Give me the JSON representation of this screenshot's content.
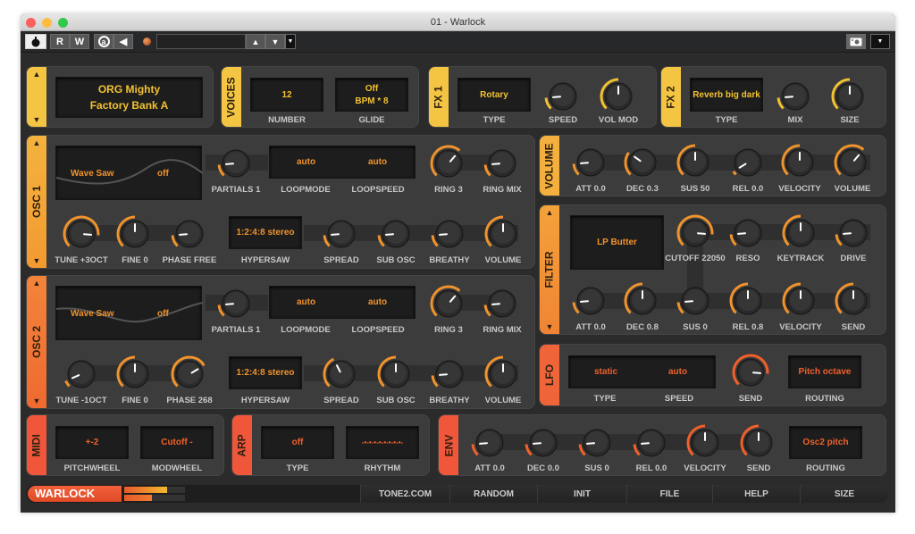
{
  "window": {
    "title": "01 - Warlock"
  },
  "host": {
    "power_icon": "power-icon",
    "read_label": "R",
    "write_label": "W",
    "auto_label": "a",
    "preset_field": "",
    "camera_icon": "camera-icon"
  },
  "colors": {
    "yellow": "#f2c230",
    "orange": "#f0932c",
    "red": "#f2602a"
  },
  "preset": {
    "name": "ORG Mighty",
    "bank": "Factory Bank A"
  },
  "voices": {
    "tab": "VOICES",
    "number": "12",
    "glide_line1": "Off",
    "glide_line2": "BPM * 8",
    "number_label": "NUMBER",
    "glide_label": "GLIDE"
  },
  "fx1": {
    "tab": "FX 1",
    "type": "Rotary",
    "type_label": "TYPE",
    "speed_label": "SPEED",
    "volmod_label": "VOL MOD",
    "speed": 0.15,
    "volmod": 0.5
  },
  "fx2": {
    "tab": "FX 2",
    "type": "Reverb big dark",
    "type_label": "TYPE",
    "mix_label": "MIX",
    "size_label": "SIZE",
    "mix": 0.15,
    "size": 0.5
  },
  "osc1": {
    "tab": "OSC 1",
    "wave": "Wave Saw",
    "wave_mode": "off",
    "loopmode": "auto",
    "loopspeed": "auto",
    "hypersaw": "1:2:4:8 stereo",
    "labels": {
      "partials": "PARTIALS 1",
      "loopmode": "LOOPMODE",
      "loopspeed": "LOOPSPEED",
      "ring": "RING 3",
      "ringmix": "RING MIX",
      "tune": "TUNE +3OCT",
      "fine": "FINE 0",
      "phase": "PHASE FREE",
      "hypersaw": "HYPERSAW",
      "spread": "SPREAD",
      "subosc": "SUB OSC",
      "breathy": "BREATHY",
      "volume": "VOLUME"
    },
    "values": {
      "partials": 0.15,
      "ring": 0.65,
      "ringmix": 0.15,
      "tune": 0.85,
      "fine": 0.5,
      "phase": 0.15,
      "spread": 0.15,
      "subosc": 0.15,
      "breathy": 0.15,
      "volume": 0.5
    }
  },
  "osc2": {
    "tab": "OSC 2",
    "wave": "Wave Saw",
    "wave_mode": "off",
    "loopmode": "auto",
    "loopspeed": "auto",
    "hypersaw": "1:2:4:8 stereo",
    "labels": {
      "partials": "PARTIALS 1",
      "loopmode": "LOOPMODE",
      "loopspeed": "LOOPSPEED",
      "ring": "RING 3",
      "ringmix": "RING MIX",
      "tune": "TUNE -1OCT",
      "fine": "FINE 0",
      "phase": "PHASE 268",
      "hypersaw": "HYPERSAW",
      "spread": "SPREAD",
      "subosc": "SUB OSC",
      "breathy": "BREATHY",
      "volume": "VOLUME"
    },
    "values": {
      "partials": 0.15,
      "ring": 0.65,
      "ringmix": 0.15,
      "tune": 0.08,
      "fine": 0.5,
      "phase": 0.72,
      "spread": 0.4,
      "subosc": 0.5,
      "breathy": 0.15,
      "volume": 0.5
    }
  },
  "volume": {
    "tab": "VOLUME",
    "labels": {
      "att": "ATT 0.0",
      "dec": "DEC 0.3",
      "sus": "SUS 50",
      "rel": "REL 0.0",
      "velocity": "VELOCITY",
      "volume": "VOLUME"
    },
    "values": {
      "att": 0.15,
      "dec": 0.3,
      "sus": 0.5,
      "rel": 0.05,
      "velocity": 0.5,
      "volume": 0.65
    }
  },
  "filter": {
    "tab": "FILTER",
    "type": "LP Butter",
    "labels": {
      "cutoff": "CUTOFF 22050",
      "reso": "RESO",
      "keytrack": "KEYTRACK",
      "drive": "DRIVE",
      "att": "ATT 0.0",
      "dec": "DEC 0.8",
      "sus": "SUS 0",
      "rel": "REL 0.8",
      "velocity": "VELOCITY",
      "send": "SEND"
    },
    "values": {
      "cutoff": 0.85,
      "reso": 0.15,
      "keytrack": 0.5,
      "drive": 0.15,
      "att": 0.15,
      "dec": 0.5,
      "sus": 0.15,
      "rel": 0.5,
      "velocity": 0.5,
      "send": 0.5
    }
  },
  "lfo": {
    "tab": "LFO",
    "type": "static",
    "speed": "auto",
    "routing": "Pitch octave",
    "labels": {
      "type": "TYPE",
      "speed": "SPEED",
      "send": "SEND",
      "routing": "ROUTING"
    },
    "values": {
      "send": 0.85
    }
  },
  "midi": {
    "tab": "MIDI",
    "pitchwheel": "+-2",
    "modwheel": "Cutoff -",
    "labels": {
      "pitchwheel": "PITCHWHEEL",
      "modwheel": "MODWHEEL"
    }
  },
  "arp": {
    "tab": "ARP",
    "type": "off",
    "rhythm": "-•-•-•-•-•-•-•-•-",
    "labels": {
      "type": "TYPE",
      "rhythm": "RHYTHM"
    }
  },
  "env": {
    "tab": "ENV",
    "routing": "Osc2 pitch",
    "labels": {
      "att": "ATT 0.0",
      "dec": "DEC 0.0",
      "sus": "SUS 0",
      "rel": "REL 0.0",
      "velocity": "VELOCITY",
      "send": "SEND",
      "routing": "ROUTING"
    },
    "values": {
      "att": 0.15,
      "dec": 0.15,
      "sus": 0.15,
      "rel": 0.15,
      "velocity": 0.5,
      "send": 0.5
    }
  },
  "footer": {
    "logo": "WARLOCK",
    "meter_left": 0.7,
    "meter_right": 0.45,
    "buttons": [
      "TONE2.COM",
      "RANDOM",
      "INIT",
      "FILE",
      "HELP",
      "SIZE"
    ]
  }
}
